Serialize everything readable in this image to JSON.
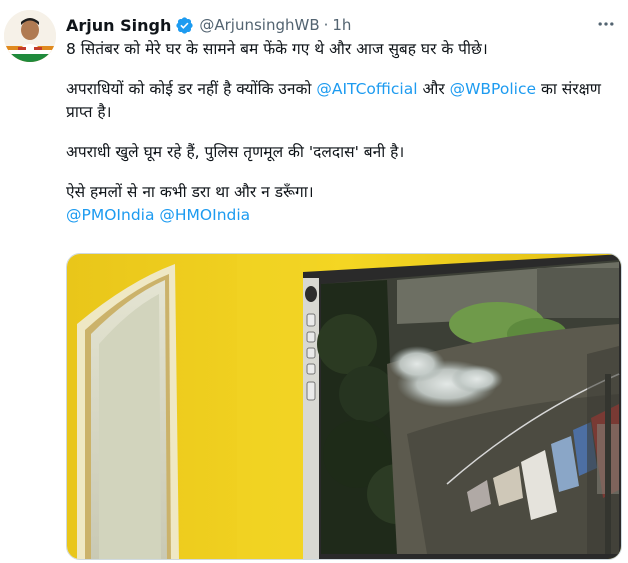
{
  "author": {
    "name": "Arjun Singh",
    "handle": "@ArjunsinghWB",
    "separator": "·",
    "time": "1h"
  },
  "tweet": {
    "line1": "8 सितंबर को मेरे घर के सामने बम फेंके गए थे और आज सुबह घर के पीछे।",
    "p2_start": "अपराधियों को कोई डर नहीं है क्योंकि उनको ",
    "p2_mention1": "@AITCofficial",
    "p2_mid": " और ",
    "p2_mention2": "@WBPolice",
    "p2_end": " का संरक्षण प्राप्त है।",
    "line3": "अपराधी खुले घूम रहे हैं, पुलिस तृणमूल की 'दलदास' बनी है।",
    "line4": "ऐसे हमलों से ना कभी डरा था और न डरूँगा।",
    "mention_pmo": "@PMOIndia",
    "mention_space": " ",
    "mention_hmo": "@HMOIndia"
  },
  "icons": {
    "verified": "verified-badge-icon",
    "more": "more-options-icon"
  },
  "colors": {
    "link": "#1d9bf0",
    "verified": "#1d9bf0",
    "secondary_text": "#536471",
    "wall_yellow": "#f2d21f"
  }
}
